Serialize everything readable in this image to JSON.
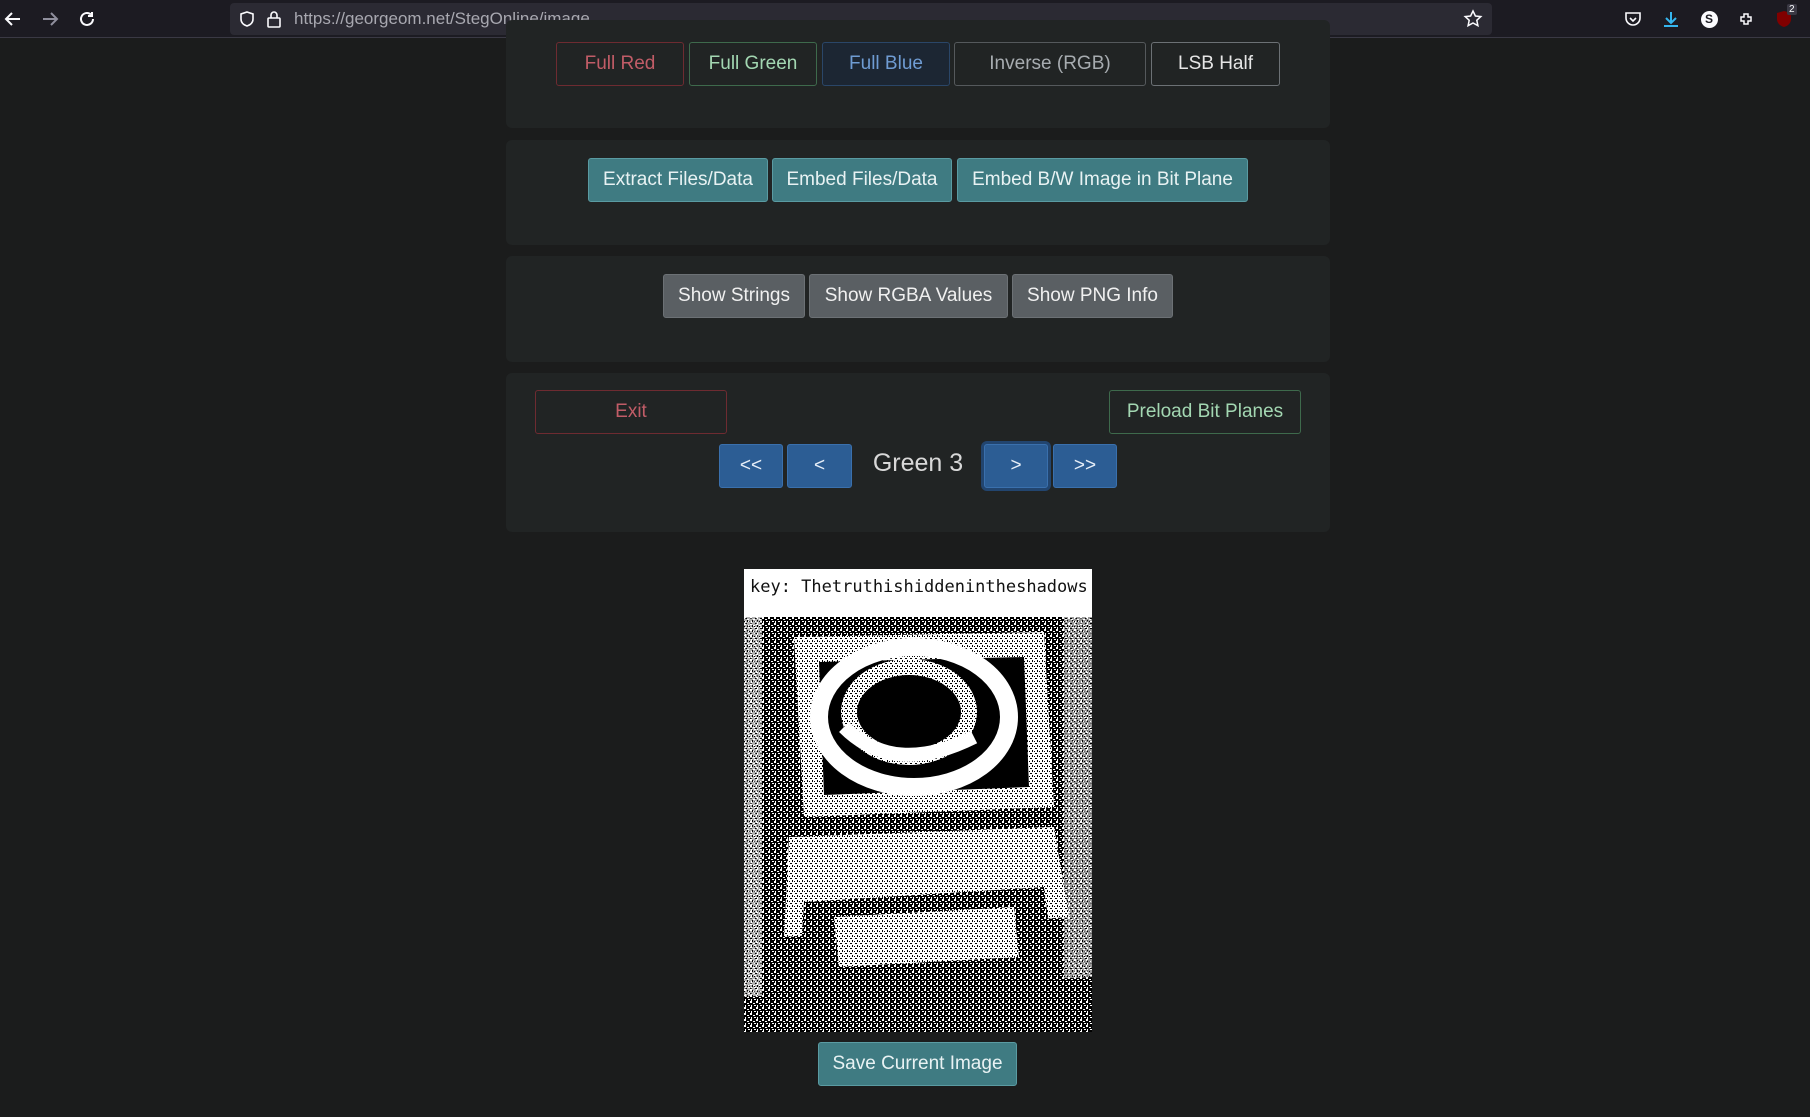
{
  "browser": {
    "url_domain": "https://georgeom.net",
    "url_path": "/StegOnline/image",
    "extensions_badge": "2",
    "extension_s_label": "S"
  },
  "view_buttons": [
    "Full Red",
    "Full Green",
    "Full Blue",
    "Inverse (RGB)",
    "LSB Half"
  ],
  "extract_buttons": [
    "Extract Files/Data",
    "Embed Files/Data",
    "Embed B/W Image in Bit Plane"
  ],
  "info_buttons": [
    "Show Strings",
    "Show RGBA Values",
    "Show PNG Info"
  ],
  "planes": {
    "exit_label": "Exit",
    "preload_label": "Preload Bit Planes",
    "first_label": "<<",
    "prev_label": "<",
    "current_plane": "Green 3",
    "next_label": ">",
    "last_label": ">>"
  },
  "image": {
    "key_text": "key: Thetruthishiddenintheshadows"
  },
  "save_label": "Save Current Image",
  "colors": {
    "background": "#1b1c1c",
    "panel": "#212424",
    "teal": "#3f7b82",
    "nav_blue": "#2c5d94",
    "exit_red": "#c15c67",
    "preload_green": "#a3d7b2"
  }
}
